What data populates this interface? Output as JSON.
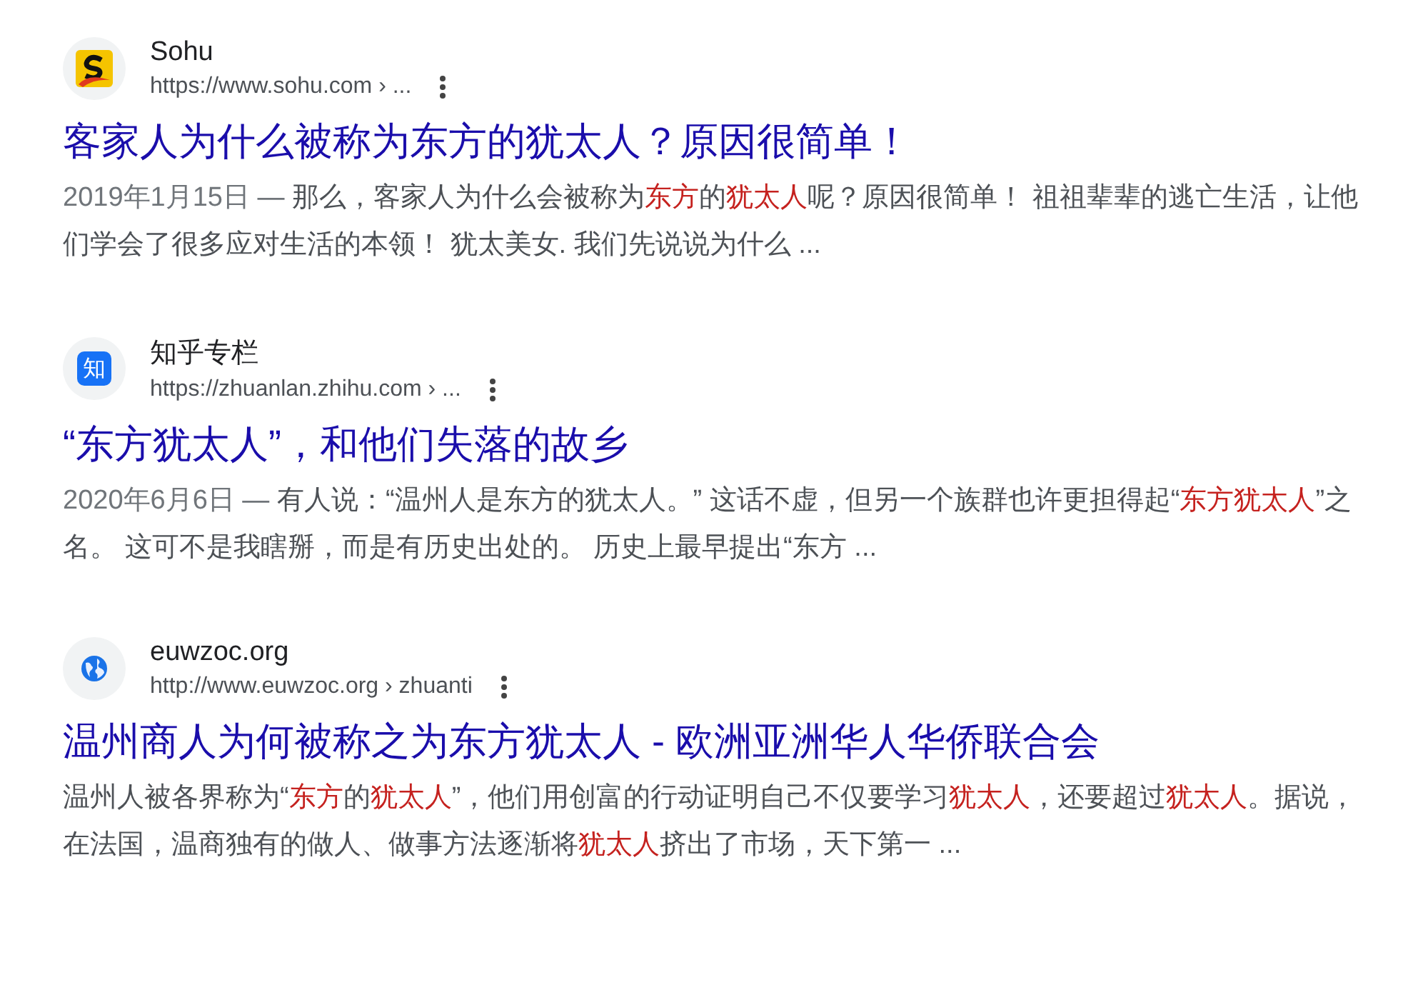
{
  "results": [
    {
      "favicon": {
        "kind": "sohu"
      },
      "site": "Sohu",
      "url": "https://www.sohu.com › ...",
      "title": "客家人为什么被称为东方的犹太人？原因很简单！",
      "date": "2019年1月15日 — ",
      "snippet": [
        {
          "text": "那么，客家人为什么会被称为",
          "highlight": false
        },
        {
          "text": "东方",
          "highlight": true
        },
        {
          "text": "的",
          "highlight": false
        },
        {
          "text": "犹太人",
          "highlight": true
        },
        {
          "text": "呢？原因很简单！ 祖祖辈辈的逃亡生活，让他们学会了很多应对生活的本领！  犹太美女. 我们先说说为什么 ...",
          "highlight": false
        }
      ]
    },
    {
      "favicon": {
        "kind": "letter",
        "text": "知"
      },
      "site": "知乎专栏",
      "url": "https://zhuanlan.zhihu.com › ...",
      "title": "“东方犹太人”，和他们失落的故乡",
      "date": "2020年6月6日 — ",
      "snippet": [
        {
          "text": "有人说：“温州人是东方的犹太人。” 这话不虚，但另一个族群也许更担得起“",
          "highlight": false
        },
        {
          "text": "东方犹太人",
          "highlight": true
        },
        {
          "text": "”之名。 这可不是我瞎掰，而是有历史出处的。 历史上最早提出“东方 ...",
          "highlight": false
        }
      ]
    },
    {
      "favicon": {
        "kind": "globe"
      },
      "site": "euwzoc.org",
      "url": "http://www.euwzoc.org › zhuanti",
      "title": "温州商人为何被称之为东方犹太人 - 欧洲亚洲华人华侨联合会",
      "snippet": [
        {
          "text": "温州人被各界称为“",
          "highlight": false
        },
        {
          "text": "东方",
          "highlight": true
        },
        {
          "text": "的",
          "highlight": false
        },
        {
          "text": "犹太人",
          "highlight": true
        },
        {
          "text": "”，他们用创富的行动证明自己不仅要学习",
          "highlight": false
        },
        {
          "text": "犹太人",
          "highlight": true
        },
        {
          "text": "，还要超过",
          "highlight": false
        },
        {
          "text": "犹太人",
          "highlight": true
        },
        {
          "text": "。据说，在法国，温商独有的做人、做事方法逐渐将",
          "highlight": false
        },
        {
          "text": "犹太人",
          "highlight": true
        },
        {
          "text": "挤出了市场，天下第一 ...",
          "highlight": false
        }
      ]
    }
  ]
}
